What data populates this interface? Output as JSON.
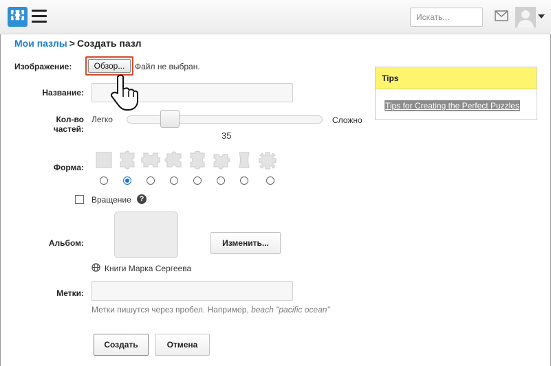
{
  "header": {
    "search_placeholder": "Искать...",
    "icons": [
      "puzzle-logo-icon",
      "hamburger-menu-icon",
      "mail-icon",
      "avatar-icon",
      "dropdown-caret-icon"
    ],
    "accent_color": "#2f8fd6"
  },
  "breadcrumb": {
    "parent": "Мои пазлы",
    "separator": ">",
    "current": "Создать пазл"
  },
  "form": {
    "image_label": "Изображение:",
    "browse_label": "Обзор...",
    "file_status": "Файл не выбран.",
    "name_label": "Название:",
    "name_value": "",
    "pieces_label_1": "Кол-во",
    "pieces_label_2": "частей:",
    "slider_min_label": "Легко",
    "slider_max_label": "Сложно",
    "pieces_value": "35",
    "shape_label": "Форма:",
    "shapes": [
      "square",
      "classic",
      "classic-2",
      "classic-3",
      "classic-4",
      "classic-5",
      "curved",
      "gear"
    ],
    "selected_shape_index": 1,
    "rotation_label": "Вращение",
    "rotation_checked": false,
    "help_glyph": "?",
    "album_label": "Альбом:",
    "change_button": "Изменить...",
    "album_name": "Книги Марка Сергеева",
    "tags_label": "Метки:",
    "tags_value": "",
    "tags_hint_prefix": "Метки пишутся через пробел. Например, ",
    "tags_hint_example": "beach \"pacific ocean\"",
    "create_button": "Создать",
    "cancel_button": "Отмена"
  },
  "tips": {
    "title": "Tips",
    "link_text": "Tips for Creating the Perfect Puzzles",
    "header_color": "#fff46e"
  }
}
